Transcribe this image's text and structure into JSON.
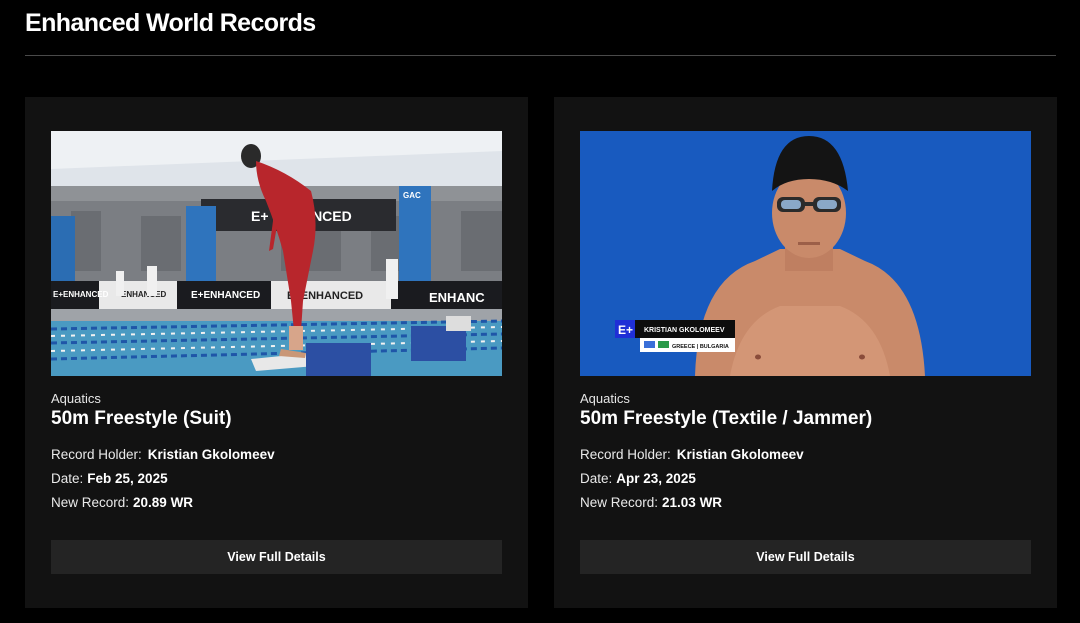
{
  "page": {
    "title": "Enhanced World Records"
  },
  "cards": [
    {
      "sport": "Aquatics",
      "event": "50m Freestyle (Suit)",
      "record_holder_label": "Record Holder:",
      "record_holder": "Kristian Gkolomeev",
      "date_label": "Date:",
      "date": "Feb 25, 2025",
      "new_record_label": "New Record:",
      "new_record": "20.89 WR",
      "button_label": "View Full Details",
      "image": {
        "banner_text": "E+ ENHANCED",
        "arena_sign": "GAC"
      }
    },
    {
      "sport": "Aquatics",
      "event": "50m Freestyle (Textile / Jammer)",
      "record_holder_label": "Record Holder:",
      "record_holder": "Kristian Gkolomeev",
      "date_label": "Date:",
      "date": "Apr 23, 2025",
      "new_record_label": "New Record:",
      "new_record": "21.03 WR",
      "button_label": "View Full Details",
      "image": {
        "lower_third_logo": "E+",
        "lower_third_name": "KRISTIAN GKOLOMEEV",
        "lower_third_country": "GREECE | BULGARIA"
      }
    }
  ],
  "colors": {
    "background": "#000000",
    "card": "#121212",
    "button": "#242424",
    "divider": "#4a4a4a",
    "brand_blue": "#1f2fd6"
  }
}
